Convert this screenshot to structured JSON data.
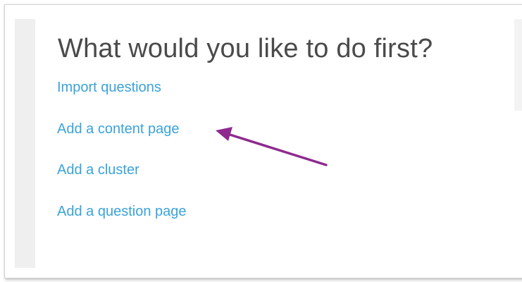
{
  "dialog": {
    "title": "What would you like to do first?",
    "options": [
      {
        "label": "Import questions"
      },
      {
        "label": "Add a content page"
      },
      {
        "label": "Add a cluster"
      },
      {
        "label": "Add a question page"
      }
    ]
  },
  "annotation": {
    "icon": "arrow-icon",
    "color": "#8e2a8e",
    "points_to": "Add a content page"
  },
  "colors": {
    "link": "#3aa3d9",
    "title": "#4a4a4a",
    "sidebar": "#efefef"
  }
}
